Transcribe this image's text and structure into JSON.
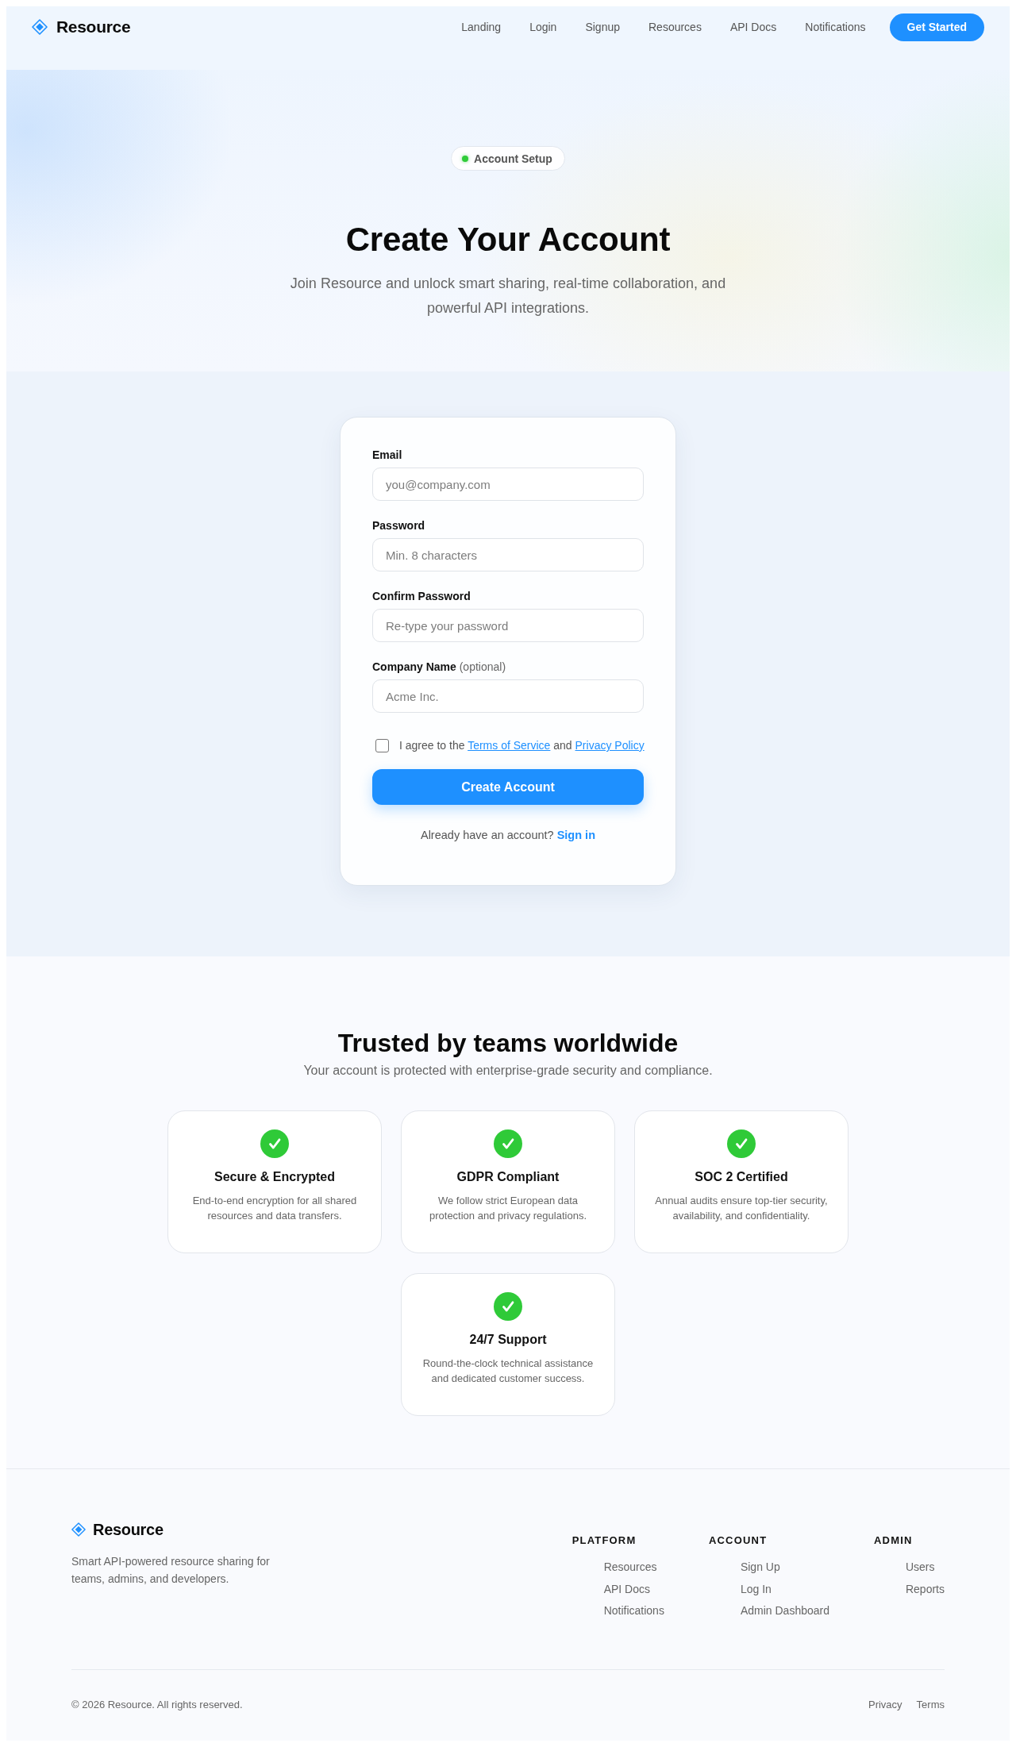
{
  "nav": {
    "brand": "Resource",
    "links": [
      "Landing",
      "Login",
      "Signup",
      "Resources",
      "API Docs",
      "Notifications"
    ],
    "cta": "Get Started"
  },
  "hero": {
    "badge": "Account Setup",
    "title": "Create Your Account",
    "subtitle": "Join Resource and unlock smart sharing, real-time collaboration, and powerful API integrations."
  },
  "form": {
    "fields": [
      {
        "label": "Email",
        "placeholder": "you@company.com"
      },
      {
        "label": "Password",
        "placeholder": "Min. 8 characters"
      },
      {
        "label": "Confirm Password",
        "placeholder": "Re-type your password"
      },
      {
        "label": "Company Name",
        "note": "(optional)",
        "placeholder": "Acme Inc."
      }
    ],
    "agreement": {
      "checked": false,
      "lead": "I agree to the",
      "terms_link": "Terms of Service",
      "joiner": "and",
      "privacy_link": "Privacy Policy"
    },
    "submit": "Create Account",
    "signin": {
      "prompt": "Already have an account?",
      "link": "Sign in"
    }
  },
  "trust": {
    "title": "Trusted by teams worldwide",
    "subtitle": "Your account is protected with enterprise-grade security and compliance.",
    "cards": [
      {
        "title": "Secure & Encrypted",
        "description": "End-to-end encryption for all shared resources and data transfers."
      },
      {
        "title": "GDPR Compliant",
        "description": "We follow strict European data protection and privacy regulations."
      },
      {
        "title": "SOC 2 Certified",
        "description": "Annual audits ensure top-tier security, availability, and confidentiality."
      },
      {
        "title": "24/7 Support",
        "description": "Round-the-clock technical assistance and dedicated customer success."
      }
    ]
  },
  "footer": {
    "brand": "Resource",
    "tagline": "Smart API-powered resource sharing for teams, admins, and developers.",
    "columns": [
      {
        "heading": "PLATFORM",
        "links": [
          "Resources",
          "API Docs",
          "Notifications"
        ]
      },
      {
        "heading": "ACCOUNT",
        "links": [
          "Sign Up",
          "Log In",
          "Admin Dashboard"
        ]
      },
      {
        "heading": "ADMIN",
        "links": [
          "Users",
          "Reports"
        ]
      }
    ],
    "copyright": "© 2026 Resource. All rights reserved.",
    "legal_links": [
      "Privacy",
      "Terms"
    ]
  }
}
